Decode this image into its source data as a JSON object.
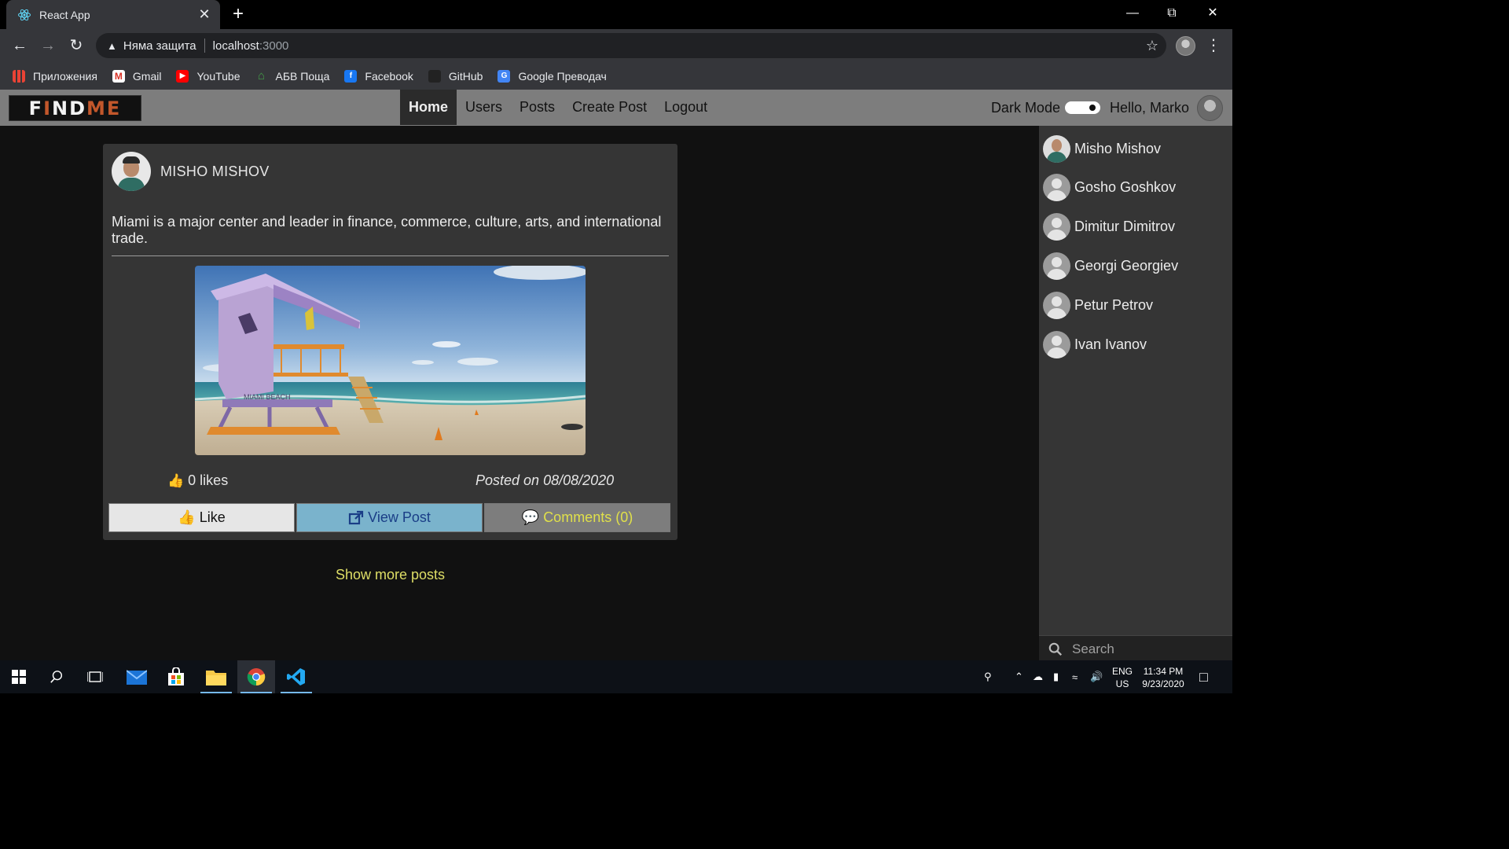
{
  "browser": {
    "tab_title": "React App",
    "address": {
      "security_text": "Няма защита",
      "host": "localhost",
      "port": ":3000"
    },
    "bookmarks": [
      {
        "label": "Приложения",
        "icon": "apps-grid-icon"
      },
      {
        "label": "Gmail",
        "icon": "gmail-icon"
      },
      {
        "label": "YouTube",
        "icon": "youtube-icon"
      },
      {
        "label": "АБВ Поща",
        "icon": "abv-mail-icon"
      },
      {
        "label": "Facebook",
        "icon": "facebook-icon"
      },
      {
        "label": "GitHub",
        "icon": "github-icon"
      },
      {
        "label": "Google Преводач",
        "icon": "google-translate-icon"
      }
    ]
  },
  "app": {
    "logo": {
      "letters_before_pin": "F",
      "pin_letter": "I",
      "letters_after_pin": "ND",
      "suffix": "ME"
    },
    "nav": [
      {
        "label": "Home",
        "active": true
      },
      {
        "label": "Users",
        "active": false
      },
      {
        "label": "Posts",
        "active": false
      },
      {
        "label": "Create Post",
        "active": false
      },
      {
        "label": "Logout",
        "active": false
      }
    ],
    "dark_mode_label": "Dark Mode",
    "dark_mode_on": true,
    "greeting": "Hello, Marko",
    "colors": {
      "navbar": "#7d7d7d",
      "card": "#353535",
      "page_bg": "#111111",
      "accent_yellow": "#dede66",
      "view_button": "#7ab3cc",
      "logo_accent": "#c2572b"
    }
  },
  "post": {
    "author": "MISHO MISHOV",
    "text": "Miami is a major center and leader in finance, commerce, culture, arts, and international trade.",
    "image_alt": "MIAMI BEACH",
    "likes_text": "0 likes",
    "posted_text": "Posted on 08/08/2020",
    "buttons": {
      "like": "Like",
      "view": "View Post",
      "comments": "Comments (0)"
    }
  },
  "show_more": "Show more posts",
  "sidebar": {
    "users": [
      {
        "name": "Misho Mishov",
        "has_photo": true
      },
      {
        "name": "Gosho Goshkov",
        "has_photo": false
      },
      {
        "name": "Dimitur Dimitrov",
        "has_photo": false
      },
      {
        "name": "Georgi Georgiev",
        "has_photo": false
      },
      {
        "name": "Petur Petrov",
        "has_photo": false
      },
      {
        "name": "Ivan Ivanov",
        "has_photo": false
      }
    ],
    "search_placeholder": "Search"
  },
  "taskbar": {
    "lang_line1": "ENG",
    "lang_line2": "US",
    "time": "11:34 PM",
    "date": "9/23/2020"
  }
}
